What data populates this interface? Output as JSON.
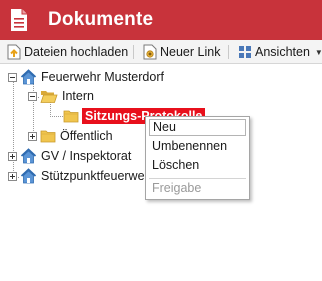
{
  "app": {
    "title": "Dokumente",
    "title_icon": "document-icon"
  },
  "toolbar": {
    "upload_label": "Dateien hochladen",
    "new_link_label": "Neuer Link",
    "views_label": "Ansichten",
    "views_chevron": "▼"
  },
  "tree": {
    "root1": {
      "label": "Feuerwehr Musterdorf",
      "expanded": true
    },
    "intern": {
      "label": "Intern",
      "expanded": true
    },
    "sitzungs": {
      "label": "Sitzungs-Protokolle",
      "selected": true
    },
    "oeffentlich": {
      "label": "Öffentlich",
      "expanded": false
    },
    "root2": {
      "label": "GV / Inspektorat",
      "expanded": false
    },
    "root3": {
      "label": "Stützpunktfeuerwehr",
      "expanded": false
    }
  },
  "context_menu": {
    "new_label": "Neu",
    "rename_label": "Umbenennen",
    "delete_label": "Löschen",
    "share_label": "Freigabe",
    "share_disabled": true
  },
  "colors": {
    "titlebar": "#c8333b",
    "selection": "#e8101c",
    "folder": "#e8c04a",
    "home_icon": "#3f7fc4"
  }
}
